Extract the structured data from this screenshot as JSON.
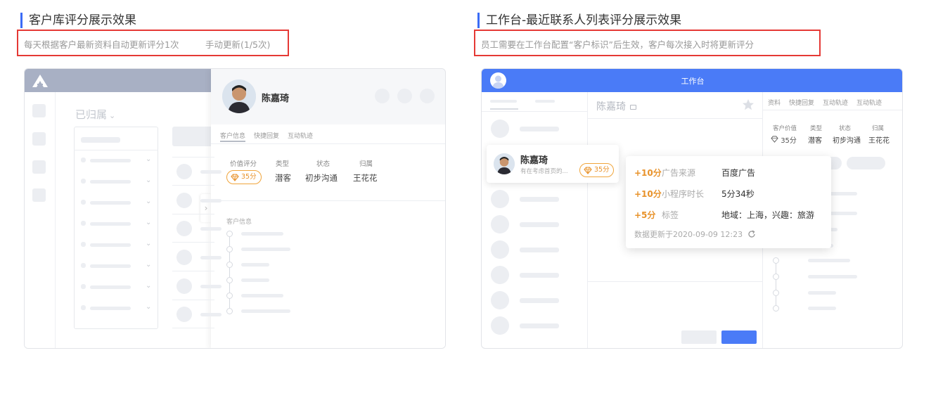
{
  "left": {
    "title": "客户库评分展示效果",
    "note_auto": "每天根据客户最新资料自动更新评分1次",
    "note_manual": "手动更新(1/5次)",
    "group_label": "已归属",
    "profile_name": "陈嘉琦",
    "tabs": [
      "客户信息",
      "快捷回复",
      "互动轨迹"
    ],
    "fields": [
      {
        "label": "价值评分",
        "value": "35分"
      },
      {
        "label": "类型",
        "value": "潜客"
      },
      {
        "label": "状态",
        "value": "初步沟通"
      },
      {
        "label": "归属",
        "value": "王花花"
      }
    ],
    "info_section_label": "客户信息"
  },
  "right": {
    "title": "工作台-最近联系人列表评分展示效果",
    "note": "员工需要在工作台配置“客户标识”后生效，客户每次接入时将更新评分",
    "header_title": "工作台",
    "chat_name": "陈嘉琦",
    "tabs": [
      "资料",
      "快捷回复",
      "互动轨迹",
      "互动轨迹"
    ],
    "fields": [
      {
        "label": "客户价值",
        "value": "35分"
      },
      {
        "label": "类型",
        "value": "潜客"
      },
      {
        "label": "状态",
        "value": "初步沟通"
      },
      {
        "label": "归属",
        "value": "王花花"
      }
    ],
    "contact": {
      "name": "陈嘉琦",
      "preview": "有在考虑首页的...",
      "score": "35分"
    },
    "score_popup": {
      "items": [
        {
          "delta": "+10分",
          "label": "广告来源",
          "value": "百度广告"
        },
        {
          "delta": "+10分",
          "label": "小程序时长",
          "value": "5分34秒"
        },
        {
          "delta": "+5分",
          "label": "标签",
          "value": "地域：上海，兴趣：旅游"
        }
      ],
      "updated": "数据更新于2020-09-09 12:23"
    }
  },
  "colors": {
    "accent": "#3b6cf6",
    "highlight_border": "#e53935",
    "score_orange": "#e8922a",
    "left_header": "#a8b0c4",
    "right_header": "#4a7bf7"
  }
}
